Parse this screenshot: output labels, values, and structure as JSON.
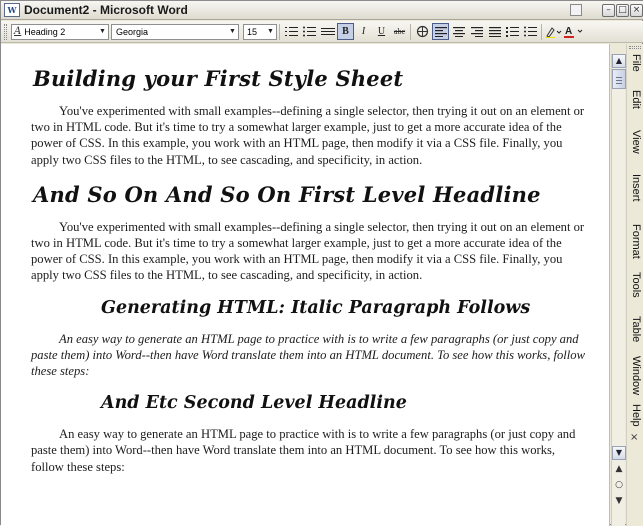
{
  "window": {
    "title": "Document2 - Microsoft Word"
  },
  "toolbar": {
    "style_value": "Heading 2",
    "font_value": "Georgia",
    "size_value": "15",
    "buttons": [
      {
        "name": "bold-button",
        "label": "B"
      },
      {
        "name": "italic-button",
        "label": "I"
      },
      {
        "name": "underline-button",
        "label": "U"
      },
      {
        "name": "strikethrough-button",
        "label": "abc"
      }
    ]
  },
  "document": {
    "blocks": [
      {
        "type": "h1",
        "text": "Building your First Style Sheet"
      },
      {
        "type": "body",
        "text": "You've experimented with small examples--defining a single selector, then trying it out on an element or two in HTML code. But it's time to try a somewhat larger example, just to get a more accurate idea of the power of CSS. In this example, you work with an HTML page, then modify it via a CSS file. Finally, you apply two CSS files to the HTML, to see cascading, and specificity, in action."
      },
      {
        "type": "h1",
        "text": "And So On And So On First Level Headline"
      },
      {
        "type": "body",
        "text": "You've experimented with small examples--defining a single selector, then trying it out on an element or two in HTML code. But it's time to try a somewhat larger example, just to get a more accurate idea of the power of CSS. In this example, you work with an HTML page, then modify it via a CSS file. Finally, you apply two CSS files to the HTML, to see cascading, and specificity, in action."
      },
      {
        "type": "h2",
        "text": "Generating HTML: Italic Paragraph Follows"
      },
      {
        "type": "italic",
        "text": "An easy way to generate an HTML page to practice with is to write a few paragraphs (or just copy and paste them) into Word--then have Word translate them into an HTML document. To see how this works, follow these steps:"
      },
      {
        "type": "h2",
        "text": "And Etc Second Level Headline"
      },
      {
        "type": "body",
        "text": "An easy way to generate an HTML page to practice with is to write a few paragraphs (or just copy and paste them) into Word--then have Word translate them into an HTML document. To see how this works, follow these steps:"
      }
    ]
  },
  "menu": {
    "items": [
      "File",
      "Edit",
      "View",
      "Insert",
      "Format",
      "Tools",
      "Table",
      "Window",
      "Help"
    ],
    "close_glyph": "×"
  },
  "icons": {
    "app": "word-document-icon",
    "scroll_up": "▲",
    "scroll_down": "▼",
    "browse_prev": "▲",
    "browse_select": "○",
    "browse_next": "▼"
  }
}
